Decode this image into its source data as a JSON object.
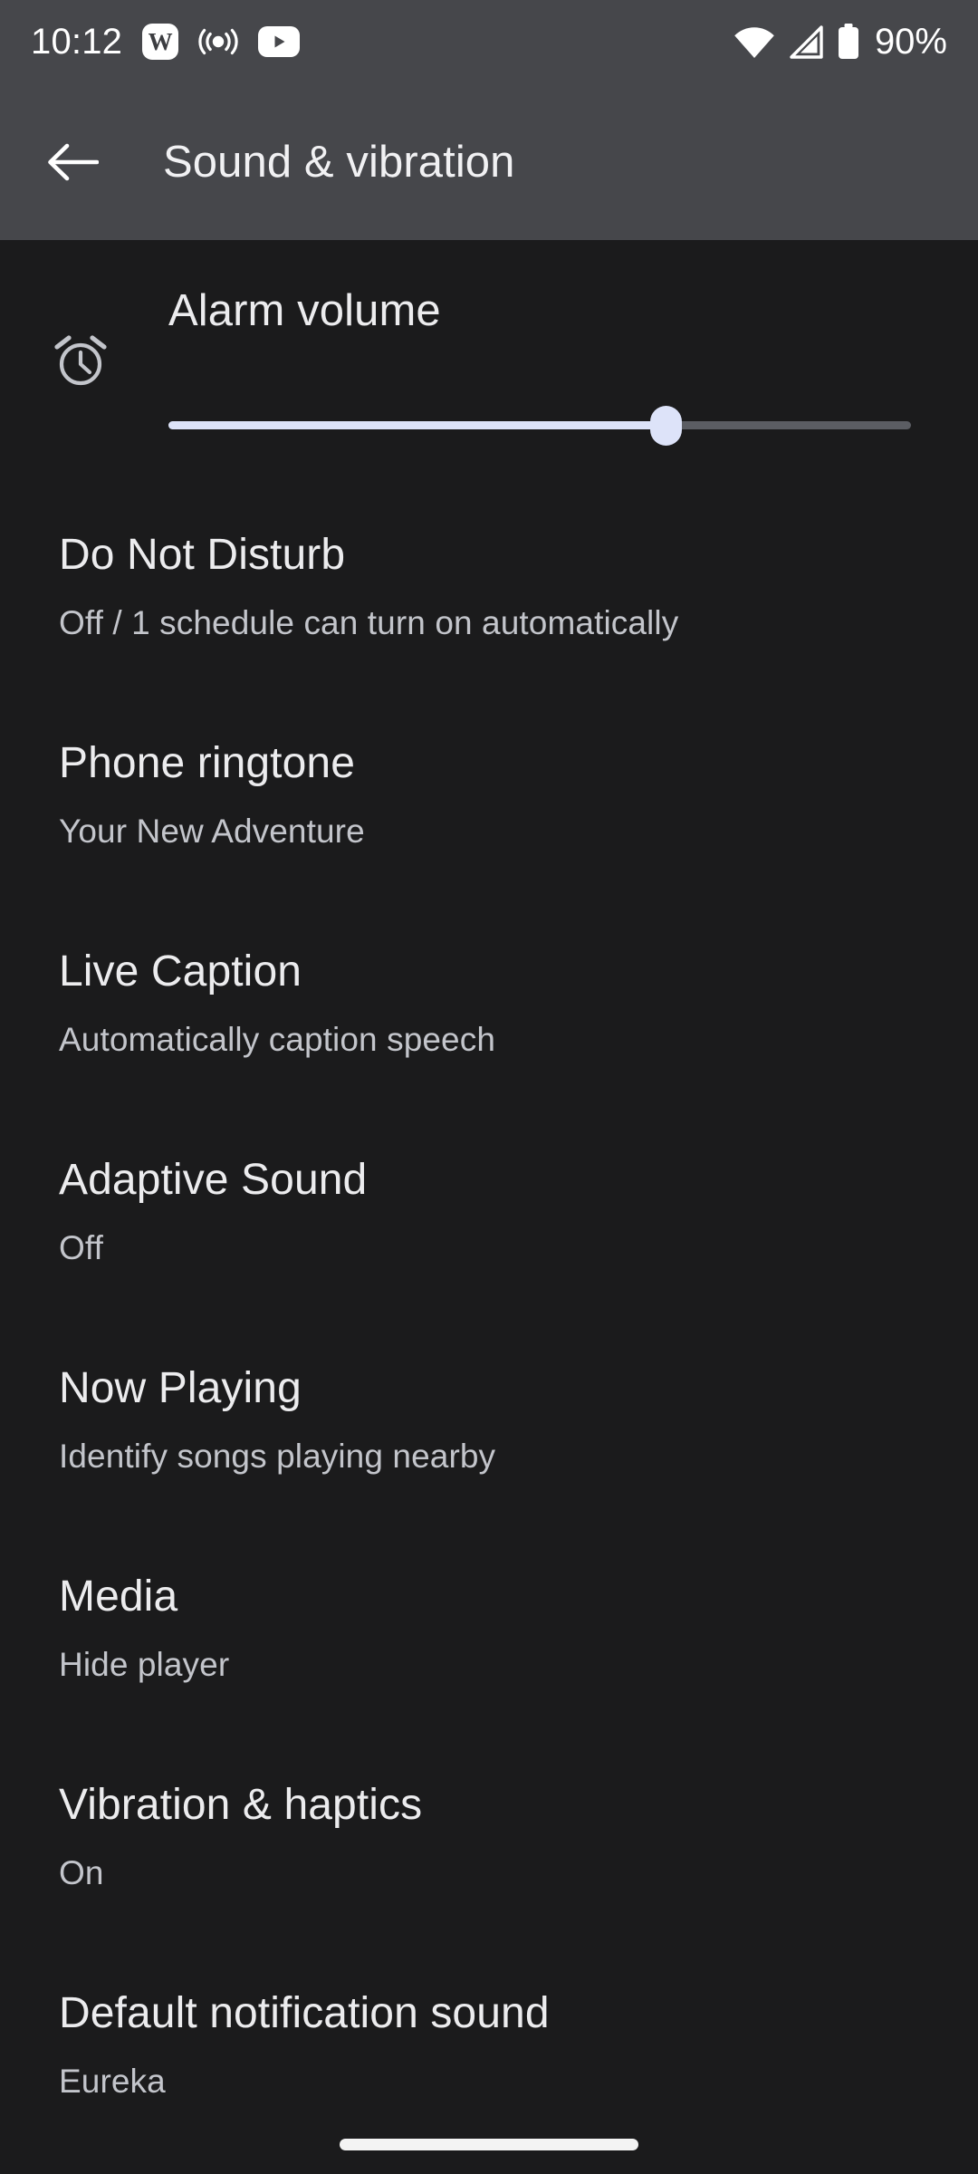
{
  "status_bar": {
    "time": "10:12",
    "battery_percent": "90%",
    "notification_icons": [
      {
        "name": "wikipedia-app-icon",
        "glyph": "W"
      },
      {
        "name": "cast-broadcast-icon",
        "glyph": "(o)"
      },
      {
        "name": "youtube-icon",
        "glyph": "▶"
      }
    ],
    "system_icons": [
      {
        "name": "wifi-icon"
      },
      {
        "name": "cellular-signal-icon"
      },
      {
        "name": "battery-icon"
      }
    ],
    "background_color": "#46474b"
  },
  "app_bar": {
    "title": "Sound & vibration",
    "back_icon": "arrow-left-icon",
    "background_color": "#46474b"
  },
  "alarm_volume": {
    "label": "Alarm volume",
    "icon": "alarm-clock-icon",
    "value_percent": 67,
    "track_color": "#5b5d63",
    "fill_color": "#dde3f9",
    "thumb_color": "#dde3f9"
  },
  "settings_items": [
    {
      "title": "Do Not Disturb",
      "subtitle": "Off / 1 schedule can turn on automatically"
    },
    {
      "title": "Phone ringtone",
      "subtitle": "Your New Adventure"
    },
    {
      "title": "Live Caption",
      "subtitle": "Automatically caption speech"
    },
    {
      "title": "Adaptive Sound",
      "subtitle": "Off"
    },
    {
      "title": "Now Playing",
      "subtitle": "Identify songs playing nearby"
    },
    {
      "title": "Media",
      "subtitle": "Hide player"
    },
    {
      "title": "Vibration & haptics",
      "subtitle": "On"
    },
    {
      "title": "Default notification sound",
      "subtitle": "Eureka"
    }
  ],
  "navigation": {
    "gesture_bar": "home-gesture-bar"
  },
  "theme": {
    "content_background": "#1b1b1c",
    "title_color": "#ececee",
    "subtitle_color": "#c3c5cb",
    "accent_color": "#dde3f9"
  }
}
